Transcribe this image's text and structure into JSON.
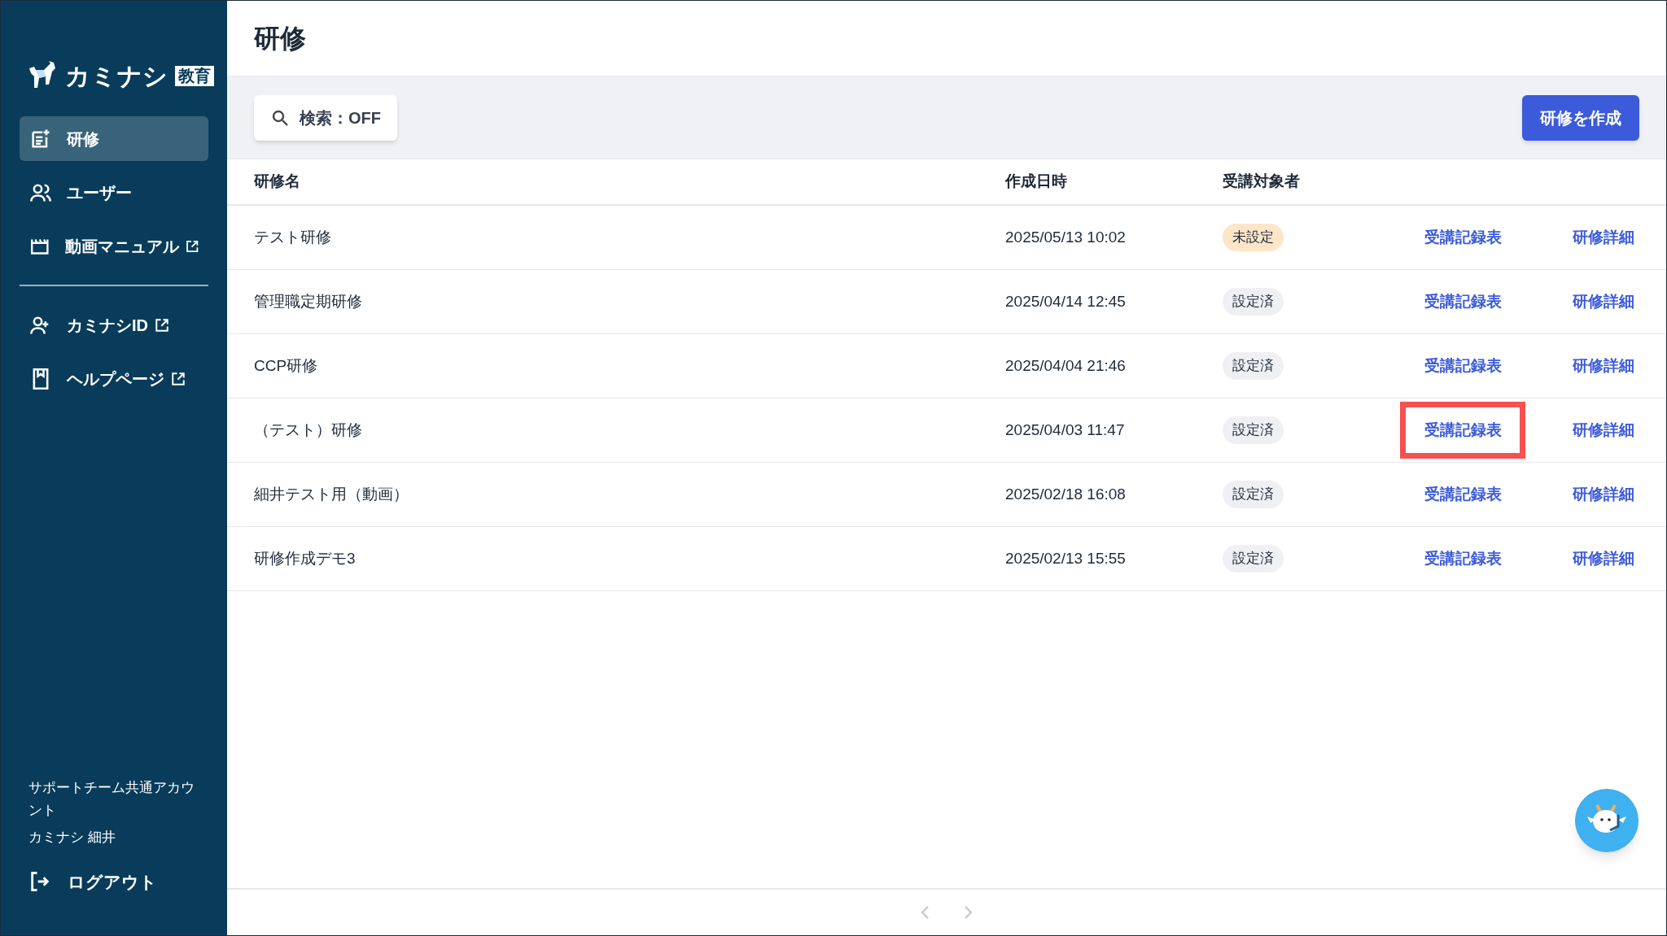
{
  "sidebar": {
    "logo": {
      "name": "カミナシ",
      "badge": "教育"
    },
    "items": [
      {
        "label": "研修",
        "kind": "doc",
        "external": false,
        "selected": true
      },
      {
        "label": "ユーザー",
        "kind": "users",
        "external": false,
        "selected": false
      },
      {
        "label": "動画マニュアル",
        "kind": "clapper",
        "external": true,
        "selected": false
      }
    ],
    "secondary_items": [
      {
        "label": "カミナシID",
        "kind": "useradd",
        "external": true,
        "selected": false
      },
      {
        "label": "ヘルプページ",
        "kind": "book",
        "external": true,
        "selected": false
      }
    ],
    "account": {
      "team": "サポートチーム共通アカウント",
      "user": "カミナシ 細井"
    },
    "logout": "ログアウト"
  },
  "page_title": "研修",
  "toolbar": {
    "search_toggle": "検索：OFF",
    "create_button": "研修を作成"
  },
  "table": {
    "columns": [
      "研修名",
      "作成日時",
      "受講対象者"
    ],
    "rows": [
      {
        "name": "テスト研修",
        "created": "2025/05/13 10:02",
        "audience": {
          "text": "未設定",
          "kind": "unset"
        },
        "record_link": "受講記録表",
        "detail_link": "研修詳細",
        "highlighted": false
      },
      {
        "name": "管理職定期研修",
        "created": "2025/04/14 12:45",
        "audience": {
          "text": "設定済",
          "kind": "set"
        },
        "record_link": "受講記録表",
        "detail_link": "研修詳細",
        "highlighted": false
      },
      {
        "name": "CCP研修",
        "created": "2025/04/04 21:46",
        "audience": {
          "text": "設定済",
          "kind": "set"
        },
        "record_link": "受講記録表",
        "detail_link": "研修詳細",
        "highlighted": false
      },
      {
        "name": "（テスト）研修",
        "created": "2025/04/03 11:47",
        "audience": {
          "text": "設定済",
          "kind": "set"
        },
        "record_link": "受講記録表",
        "detail_link": "研修詳細",
        "highlighted": true
      },
      {
        "name": "細井テスト用（動画）",
        "created": "2025/02/18 16:08",
        "audience": {
          "text": "設定済",
          "kind": "set"
        },
        "record_link": "受講記録表",
        "detail_link": "研修詳細",
        "highlighted": false
      },
      {
        "name": "研修作成デモ3",
        "created": "2025/02/13 15:55",
        "audience": {
          "text": "設定済",
          "kind": "set"
        },
        "record_link": "受講記録表",
        "detail_link": "研修詳細",
        "highlighted": false
      }
    ]
  }
}
